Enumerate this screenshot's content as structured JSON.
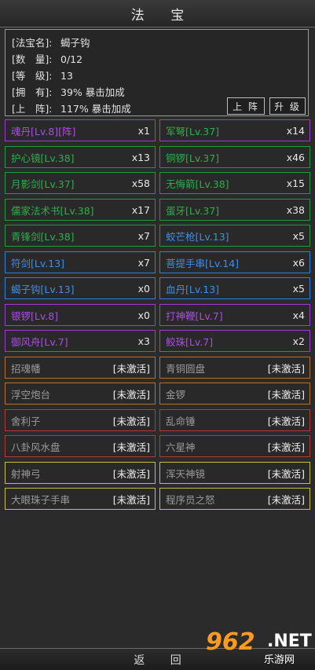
{
  "title": "法 宝",
  "info": {
    "name_label": "[法宝名]:",
    "name_value": "蝎子钩",
    "count_label": "[数　量]:",
    "count_value": "0/12",
    "level_label": "[等　级]:",
    "level_value": "13",
    "own_label": "[拥　有]:",
    "own_value": "39% 暴击加成",
    "deploy_label": "[上　阵]:",
    "deploy_value": "117% 暴击加成",
    "deploy_button": "上 阵",
    "upgrade_button": "升 级"
  },
  "left_items": [
    {
      "name": "魂丹[Lv.8][阵]",
      "count": "x1",
      "color": "#a94fe0"
    },
    {
      "name": "护心镜[Lv.38]",
      "count": "x13",
      "color": "#2fae4b"
    },
    {
      "name": "月影剑[Lv.37]",
      "count": "x58",
      "color": "#2fae4b"
    },
    {
      "name": "儒家法术书[Lv.38]",
      "count": "x17",
      "color": "#2fae4b"
    },
    {
      "name": "青锋剑[Lv.38]",
      "count": "x7",
      "color": "#2fae4b"
    },
    {
      "name": "符剑[Lv.13]",
      "count": "x7",
      "color": "#3f8ee8"
    },
    {
      "name": "蝎子钩[Lv.13]",
      "count": "x0",
      "color": "#3f8ee8"
    },
    {
      "name": "银锣[Lv.8]",
      "count": "x0",
      "color": "#a94fe0"
    },
    {
      "name": "御风舟[Lv.7]",
      "count": "x3",
      "color": "#a94fe0"
    },
    {
      "name": "招魂幡",
      "count": "[未激活]",
      "color": "#9a9a9a"
    },
    {
      "name": "浮空炮台",
      "count": "[未激活]",
      "color": "#9a9a9a"
    },
    {
      "name": "舍利子",
      "count": "[未激活]",
      "color": "#9a9a9a"
    },
    {
      "name": "八卦风水盘",
      "count": "[未激活]",
      "color": "#9a9a9a"
    },
    {
      "name": "射神弓",
      "count": "[未激活]",
      "color": "#9a9a9a"
    },
    {
      "name": "大眼珠子手串",
      "count": "[未激活]",
      "color": "#9a9a9a"
    }
  ],
  "right_items": [
    {
      "name": "军弩[Lv.37]",
      "count": "x14",
      "color": "#2fae4b"
    },
    {
      "name": "铜锣[Lv.37]",
      "count": "x46",
      "color": "#2fae4b"
    },
    {
      "name": "无悔箭[Lv.38]",
      "count": "x15",
      "color": "#2fae4b"
    },
    {
      "name": "蛋牙[Lv.37]",
      "count": "x38",
      "color": "#2fae4b"
    },
    {
      "name": "蛟芒枪[Lv.13]",
      "count": "x5",
      "color": "#3f8ee8"
    },
    {
      "name": "菩提手串[Lv.14]",
      "count": "x6",
      "color": "#3f8ee8"
    },
    {
      "name": "血丹[Lv.13]",
      "count": "x5",
      "color": "#3f8ee8"
    },
    {
      "name": "打神鞭[Lv.7]",
      "count": "x4",
      "color": "#a94fe0"
    },
    {
      "name": "鲛珠[Lv.7]",
      "count": "x2",
      "color": "#a94fe0"
    },
    {
      "name": "青铜圆盘",
      "count": "[未激活]",
      "color": "#9a9a9a"
    },
    {
      "name": "金锣",
      "count": "[未激活]",
      "color": "#9a9a9a"
    },
    {
      "name": "乱命锤",
      "count": "[未激活]",
      "color": "#9a9a9a"
    },
    {
      "name": "六星神",
      "count": "[未激活]",
      "color": "#9a9a9a"
    },
    {
      "name": "浑天神镜",
      "count": "[未激活]",
      "color": "#9a9a9a"
    },
    {
      "name": "程序员之怒",
      "count": "[未激活]",
      "color": "#9a9a9a"
    }
  ],
  "borders": {
    "purple": "#9b3fd0",
    "green": "#1e9a3e",
    "blue": "#2e7fd8",
    "orange": "#b8702e",
    "red": "#b23a3a",
    "yellow": "#c9c03a"
  },
  "footer": "返 回",
  "watermark": {
    "big": "962",
    "net": ".NET",
    "sub": "乐游网"
  }
}
